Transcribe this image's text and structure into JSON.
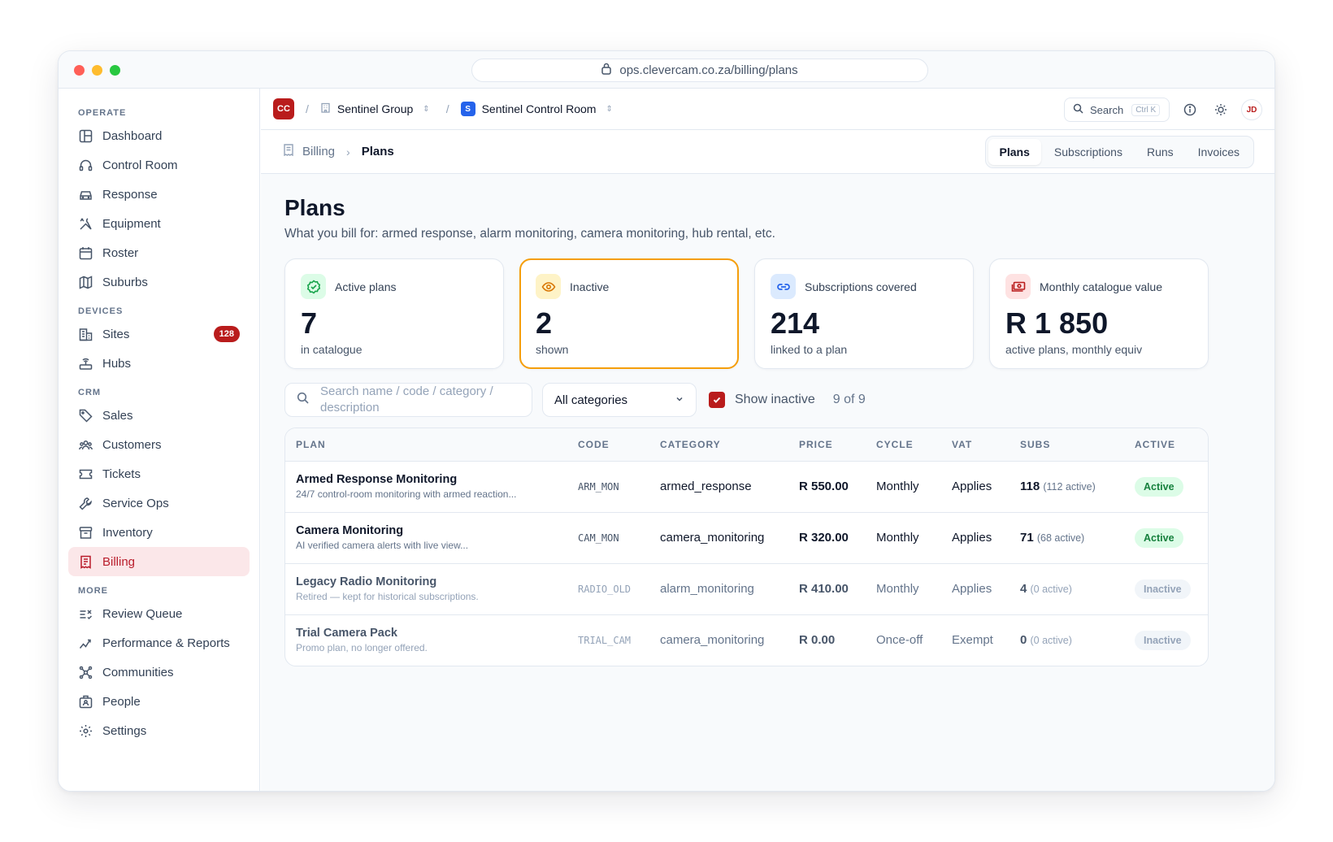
{
  "browser": {
    "url": "ops.clevercam.co.za/billing/plans"
  },
  "colors": {
    "brand": "#b91c1c",
    "highlight_border": "#f59e0b",
    "active_pill": "#dcfce7"
  },
  "sidebar": {
    "sections": [
      {
        "label": "OPERATE",
        "items": [
          {
            "label": "Dashboard",
            "icon": "layout-icon"
          },
          {
            "label": "Control Room",
            "icon": "headset-icon"
          },
          {
            "label": "Response",
            "icon": "car-icon"
          },
          {
            "label": "Equipment",
            "icon": "tools-icon"
          },
          {
            "label": "Roster",
            "icon": "calendar-icon"
          },
          {
            "label": "Suburbs",
            "icon": "map-icon"
          }
        ]
      },
      {
        "label": "DEVICES",
        "items": [
          {
            "label": "Sites",
            "icon": "building-icon",
            "badge": "128"
          },
          {
            "label": "Hubs",
            "icon": "router-icon"
          }
        ]
      },
      {
        "label": "CRM",
        "items": [
          {
            "label": "Sales",
            "icon": "tag-icon"
          },
          {
            "label": "Customers",
            "icon": "users-icon"
          },
          {
            "label": "Tickets",
            "icon": "ticket-icon"
          },
          {
            "label": "Service Ops",
            "icon": "wrench-icon"
          },
          {
            "label": "Inventory",
            "icon": "archive-icon"
          },
          {
            "label": "Billing",
            "icon": "receipt-icon",
            "active": true
          }
        ]
      },
      {
        "label": "MORE",
        "items": [
          {
            "label": "Review Queue",
            "icon": "list-check-icon"
          },
          {
            "label": "Performance & Reports",
            "icon": "trend-icon"
          },
          {
            "label": "Communities",
            "icon": "network-icon"
          },
          {
            "label": "People",
            "icon": "id-card-icon"
          },
          {
            "label": "Settings",
            "icon": "gear-icon"
          }
        ]
      }
    ]
  },
  "topbar": {
    "logo": "CC",
    "org": "Sentinel Group",
    "room_logo": "S",
    "room": "Sentinel Control Room",
    "search_label": "Search",
    "search_kbd": "Ctrl K",
    "avatar": "JD"
  },
  "breadcrumb": {
    "parent": "Billing",
    "current": "Plans"
  },
  "tabs": [
    "Plans",
    "Subscriptions",
    "Runs",
    "Invoices"
  ],
  "page": {
    "title": "Plans",
    "subtitle": "What you bill for: armed response, alarm monitoring, camera monitoring, hub rental, etc."
  },
  "cards": [
    {
      "label": "Active plans",
      "value": "7",
      "note": "in catalogue",
      "icon": "badge-check-icon"
    },
    {
      "label": "Inactive",
      "value": "2",
      "note": "shown",
      "icon": "eye-icon"
    },
    {
      "label": "Subscriptions covered",
      "value": "214",
      "note": "linked to a plan",
      "icon": "link-icon"
    },
    {
      "label": "Monthly catalogue value",
      "value": "R 1 850",
      "note": "active plans, monthly equiv",
      "icon": "money-icon"
    }
  ],
  "filters": {
    "search_placeholder": "Search name / code / category / description",
    "category": "All categories",
    "show_inactive": "Show inactive",
    "count": "9 of 9"
  },
  "table": {
    "headers": [
      "PLAN",
      "CODE",
      "CATEGORY",
      "PRICE",
      "CYCLE",
      "VAT",
      "SUBS",
      "ACTIVE"
    ],
    "rows": [
      {
        "name": "Armed Response Monitoring",
        "desc": "24/7 control-room monitoring with armed reaction...",
        "code": "ARM_MON",
        "category": "armed_response",
        "price": "R 550.00",
        "cycle": "Monthly",
        "vat": "Applies",
        "subs": "118",
        "subs_active": "(112 active)",
        "status": "Active"
      },
      {
        "name": "Camera Monitoring",
        "desc": "AI verified camera alerts with live view...",
        "code": "CAM_MON",
        "category": "camera_monitoring",
        "price": "R 320.00",
        "cycle": "Monthly",
        "vat": "Applies",
        "subs": "71",
        "subs_active": "(68 active)",
        "status": "Active"
      },
      {
        "name": "Legacy Radio Monitoring",
        "desc": "Retired — kept for historical subscriptions.",
        "code": "RADIO_OLD",
        "category": "alarm_monitoring",
        "price": "R 410.00",
        "cycle": "Monthly",
        "vat": "Applies",
        "subs": "4",
        "subs_active": "(0 active)",
        "status": "Inactive"
      },
      {
        "name": "Trial Camera Pack",
        "desc": "Promo plan, no longer offered.",
        "code": "TRIAL_CAM",
        "category": "camera_monitoring",
        "price": "R 0.00",
        "cycle": "Once-off",
        "vat": "Exempt",
        "subs": "0",
        "subs_active": "(0 active)",
        "status": "Inactive"
      }
    ]
  }
}
